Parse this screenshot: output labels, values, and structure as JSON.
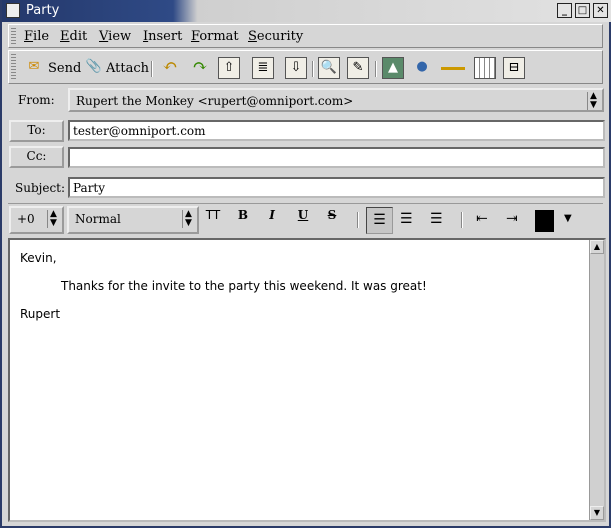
{
  "window": {
    "title": "Party"
  },
  "menu": [
    "File",
    "Edit",
    "View",
    "Insert",
    "Format",
    "Security"
  ],
  "toolbar": {
    "send": "Send",
    "attach": "Attach"
  },
  "header": {
    "from_label": "From:",
    "from_value": "Rupert the Monkey <rupert@omniport.com>",
    "to_label": "To:",
    "to_value": "tester@omniport.com",
    "cc_label": "Cc:",
    "cc_value": "",
    "subject_label": "Subject:",
    "subject_value": "Party"
  },
  "format": {
    "size": "+0",
    "style": "Normal",
    "tt": "TT",
    "bold": "B",
    "italic": "I",
    "underline": "U",
    "strike": "S",
    "color": "#000000"
  },
  "body": {
    "greeting": "Kevin,",
    "text": "Thanks for the invite to the party this weekend.  It was great!",
    "signature": "Rupert"
  }
}
